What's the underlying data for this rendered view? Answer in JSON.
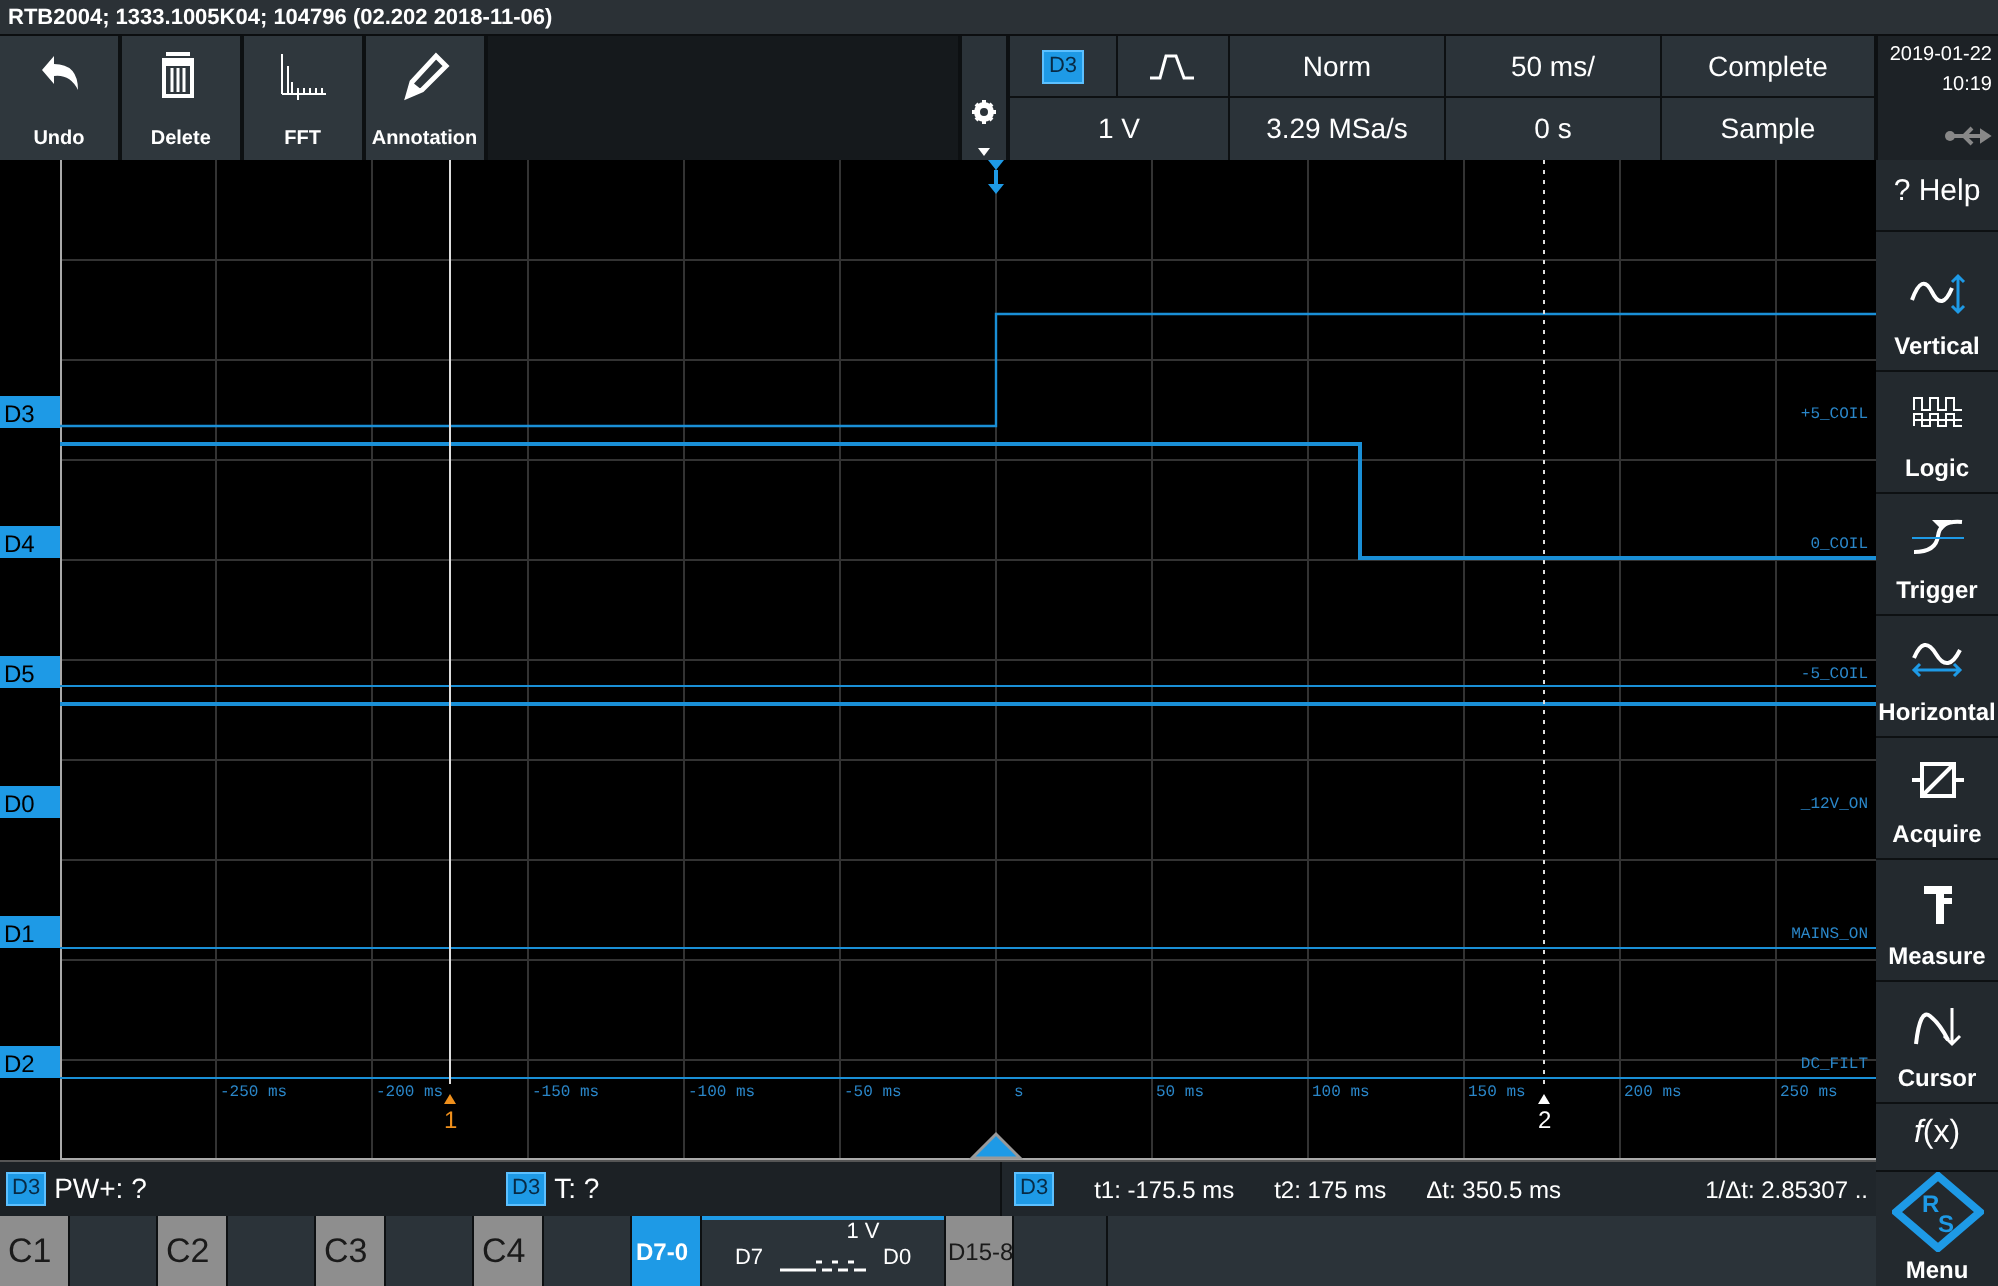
{
  "title_bar": "RTB2004; 1333.1005K04; 104796 (02.202 2018-11-06)",
  "toolbar": [
    {
      "label": "Undo",
      "kind": "undo"
    },
    {
      "label": "Delete",
      "kind": "delete"
    },
    {
      "label": "FFT",
      "kind": "fft"
    },
    {
      "label": "Annotation",
      "kind": "annotation"
    }
  ],
  "settings_panel": {
    "trigger_source": "D3",
    "mode": "Norm",
    "timebase": "50 ms/",
    "acquisition_state": "Complete",
    "trigger_threshold": "1 V",
    "sample_rate": "3.29 MSa/s",
    "horizontal_position": "0 s",
    "acquisition_mode": "Sample"
  },
  "clock": {
    "date": "2019-01-22",
    "time": "10:19"
  },
  "plot": {
    "channels": [
      {
        "label": "D3",
        "signal": "+5_COIL"
      },
      {
        "label": "D4",
        "signal": "0_COIL"
      },
      {
        "label": "D5",
        "signal": "-5_COIL"
      },
      {
        "label": "D0",
        "signal": "_12V_ON"
      },
      {
        "label": "D1",
        "signal": "MAINS_ON"
      },
      {
        "label": "D2",
        "signal": "DC_FILT"
      }
    ],
    "time_labels": [
      "-250 ms",
      "-200 ms",
      "-150 ms",
      "-100 ms",
      "-50 ms",
      "s",
      "50 ms",
      "100 ms",
      "150 ms",
      "200 ms",
      "250 ms"
    ],
    "cursors": [
      {
        "label": "1",
        "color": "#f0901c"
      },
      {
        "label": "2",
        "color": "#ffffff"
      }
    ]
  },
  "sidebar": [
    {
      "label": "? Help",
      "kind": "help"
    },
    {
      "label": "Vertical",
      "kind": "vertical"
    },
    {
      "label": "Logic",
      "kind": "logic"
    },
    {
      "label": "Trigger",
      "kind": "trigger"
    },
    {
      "label": "Horizontal",
      "kind": "horizontal"
    },
    {
      "label": "Acquire",
      "kind": "acquire"
    },
    {
      "label": "Measure",
      "kind": "measure"
    },
    {
      "label": "Cursor",
      "kind": "cursor"
    },
    {
      "label": "*f*(x)",
      "kind": "function"
    },
    {
      "label": "Menu",
      "kind": "menu",
      "logo_letters": [
        "R",
        "S"
      ]
    }
  ],
  "measurements": [
    {
      "source": "D3",
      "text": "PW+: ?"
    },
    {
      "source": "D3",
      "text": "T: ?"
    }
  ],
  "cursor_readout": {
    "source": "D3",
    "values": [
      "t1: -175.5 ms",
      "t2: 175 ms",
      "Δt: 350.5 ms",
      "1/Δt: 2.85307 .."
    ]
  },
  "channel_tabs": [
    {
      "label": "C1",
      "selected": false
    },
    {
      "label": "C2",
      "selected": false
    },
    {
      "label": "C3",
      "selected": false
    },
    {
      "label": "C4",
      "selected": false
    },
    {
      "label": "D7-0",
      "selected": true,
      "scale": "1 V",
      "first_bit": "D7",
      "last_bit": "D0"
    },
    {
      "label": "D15-8",
      "selected": false
    }
  ]
}
